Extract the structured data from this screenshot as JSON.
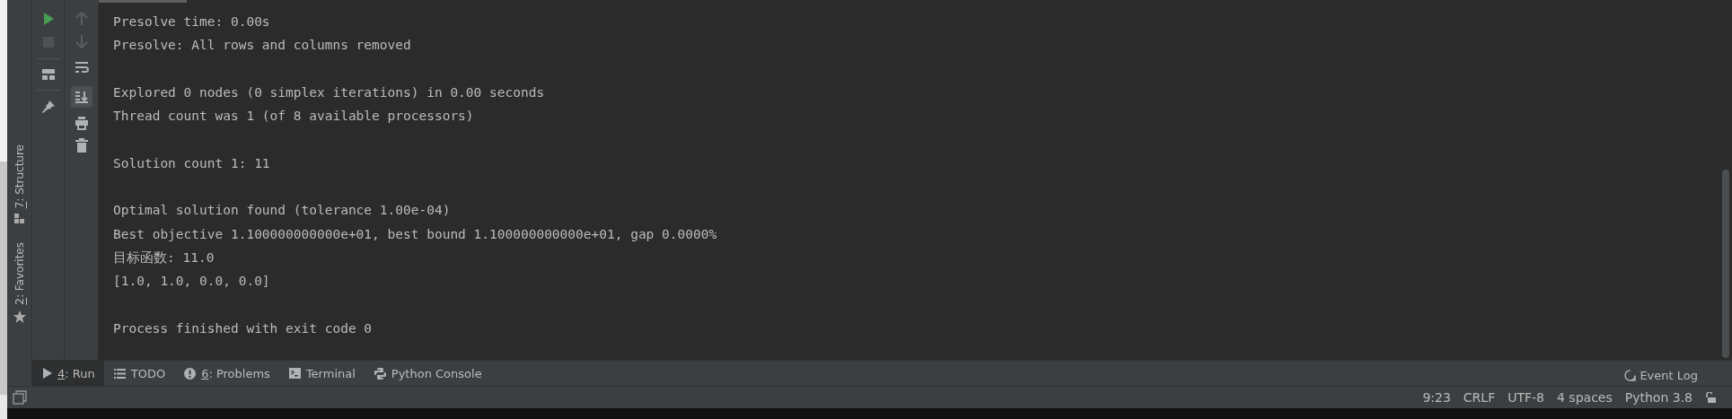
{
  "side_bar": {
    "items": [
      {
        "kind": "structure",
        "mnemonic": "7",
        "label": ": Structure"
      },
      {
        "kind": "favorites",
        "mnemonic": "2",
        "label": ": Favorites"
      }
    ]
  },
  "run_toolbar": {
    "buttons": [
      {
        "kind": "run",
        "disabled": false
      },
      {
        "kind": "stop",
        "disabled": true
      },
      {
        "kind": "layout"
      },
      {
        "kind": "pin"
      }
    ]
  },
  "console_toolbar": {
    "buttons": [
      {
        "kind": "up",
        "disabled": true
      },
      {
        "kind": "down",
        "disabled": true
      },
      {
        "kind": "wrap",
        "on": false
      },
      {
        "kind": "scroll-end",
        "on": true
      },
      {
        "kind": "print"
      },
      {
        "kind": "trash"
      }
    ]
  },
  "console": {
    "blocks": [
      [
        "Presolve time: 0.00s",
        "Presolve: All rows and columns removed"
      ],
      [
        "Explored 0 nodes (0 simplex iterations) in 0.00 seconds",
        "Thread count was 1 (of 8 available processors)"
      ],
      [
        "Solution count 1: 11"
      ],
      [
        "Optimal solution found (tolerance 1.00e-04)",
        "Best objective 1.100000000000e+01, best bound 1.100000000000e+01, gap 0.0000%",
        "目标函数: 11.0",
        "[1.0, 1.0, 0.0, 0.0]"
      ],
      [
        "Process finished with exit code 0"
      ]
    ]
  },
  "tool_tabs": [
    {
      "kind": "run",
      "mnemonic": "4",
      "label": ": Run",
      "selected": true
    },
    {
      "kind": "todo",
      "label": "TODO",
      "selected": false
    },
    {
      "kind": "problems",
      "mnemonic": "6",
      "label": ": Problems",
      "selected": false
    },
    {
      "kind": "terminal",
      "label": "Terminal",
      "selected": false
    },
    {
      "kind": "python",
      "label": "Python Console",
      "selected": false
    }
  ],
  "event_log": {
    "label": "Event Log"
  },
  "status_bar": {
    "items": [
      "9:23",
      "CRLF",
      "UTF-8",
      "4 spaces",
      "Python 3.8"
    ]
  }
}
